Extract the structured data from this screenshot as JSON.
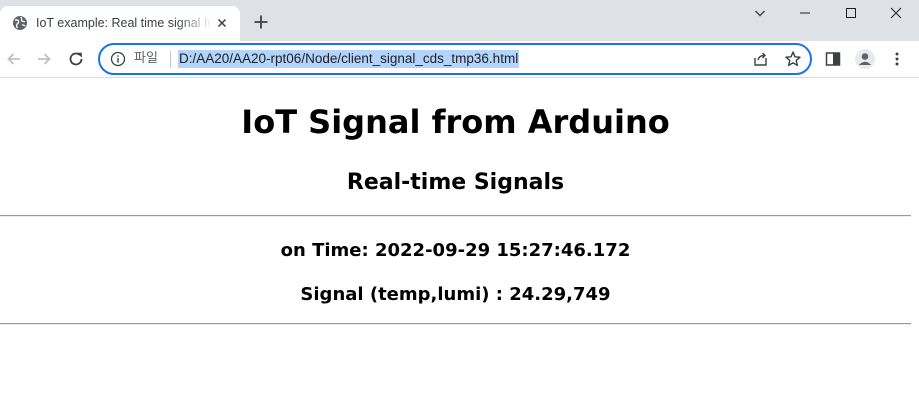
{
  "browser": {
    "tab": {
      "title": "IoT example: Real time signal from Arduino",
      "favicon": "globe-icon"
    },
    "address_bar": {
      "scheme_label": "파일",
      "url": "D:/AA20/AA20-rpt06/Node/client_signal_cds_tmp36.html"
    },
    "icons": {
      "back": "arrow-left-icon",
      "forward": "arrow-right-icon",
      "reload": "reload-icon",
      "info": "info-icon",
      "share": "share-icon",
      "bookmark": "star-icon",
      "side_panel": "side-panel-icon",
      "profile": "profile-icon",
      "menu": "kebab-menu-icon"
    },
    "colors": {
      "tabstrip": "#dee1e6",
      "focus_ring": "#1a73e8",
      "url_selection": "#b3d4fc"
    }
  },
  "page": {
    "title": "IoT Signal from Arduino",
    "subtitle": "Real-time Signals",
    "time_line": "on Time: 2022-09-29 15:27:46.172",
    "signal_line": "Signal (temp,lumi) : 24.29,749"
  }
}
